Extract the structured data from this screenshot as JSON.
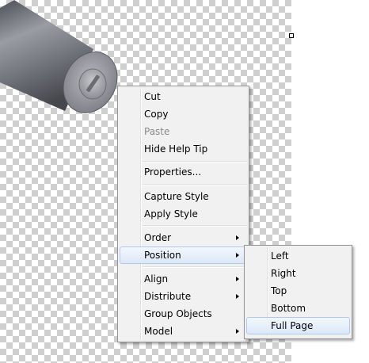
{
  "context_menu": {
    "items": [
      {
        "label": "Cut"
      },
      {
        "label": "Copy"
      },
      {
        "label": "Paste",
        "disabled": true
      },
      {
        "label": "Hide Help Tip"
      },
      {
        "label": "Properties..."
      },
      {
        "label": "Capture Style"
      },
      {
        "label": "Apply Style"
      },
      {
        "label": "Order",
        "submenu": true
      },
      {
        "label": "Position",
        "submenu": true,
        "highlighted": true
      },
      {
        "label": "Align",
        "submenu": true
      },
      {
        "label": "Distribute",
        "submenu": true
      },
      {
        "label": "Group Objects"
      },
      {
        "label": "Model",
        "submenu": true
      }
    ]
  },
  "position_submenu": {
    "items": [
      {
        "label": "Left"
      },
      {
        "label": "Right"
      },
      {
        "label": "Top"
      },
      {
        "label": "Bottom"
      },
      {
        "label": "Full Page",
        "highlighted": true
      }
    ]
  },
  "colors": {
    "menu_background": "#f1f1f1",
    "menu_border": "#979797",
    "highlight_border": "#aecbef",
    "disabled_text": "#8a8a8a"
  }
}
